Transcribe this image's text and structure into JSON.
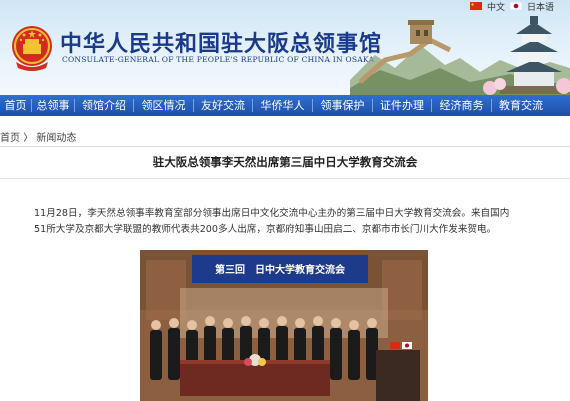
{
  "site": {
    "title_cn": "中华人民共和国驻大阪总领事馆",
    "title_en": "CONSULATE-GENERAL OF THE PEOPLE'S REPUBLIC OF CHINA IN OSAKA",
    "languages": [
      "中文",
      "日本语"
    ]
  },
  "nav": {
    "items": [
      "首页",
      "总领事",
      "领馆介绍",
      "领区情况",
      "友好交流",
      "华侨华人",
      "领事保护",
      "证件办理",
      "经济商务",
      "教育交流"
    ]
  },
  "breadcrumb": {
    "home": "首页",
    "sep": "〉",
    "current": "新闻动态"
  },
  "article": {
    "title": "驻大阪总领事李天然出席第三届中日大学教育交流会",
    "line1": "11月28日，李天然总领事率教育室部分领事出席日中文化交流中心主办的第三届中日大学教育交流会。来自国内",
    "line2": "51所大学及京都大学联盟的教师代表共200多人出席，京都府知事山田启二、京都市市长门川大作发来贺电。"
  },
  "photo": {
    "banner_text": "第三回　日中大学教育交流会"
  },
  "colors": {
    "nav": "#1d4fa8",
    "title": "#1a3a8c"
  }
}
